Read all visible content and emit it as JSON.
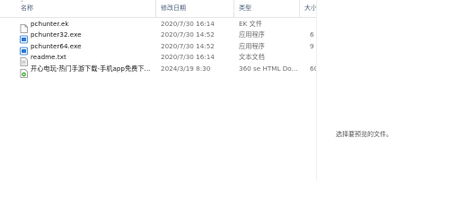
{
  "columns": {
    "name": "名称",
    "date": "修改日期",
    "type": "类型",
    "size": "大小"
  },
  "files": [
    {
      "name": "pchunter.ek",
      "date": "2020/7/30 16:14",
      "type": "EK 文件",
      "size": "",
      "icon": "blank-file-icon"
    },
    {
      "name": "pchunter32.exe",
      "date": "2020/7/30 14:52",
      "type": "应用程序",
      "size": "6",
      "icon": "exe-file-icon"
    },
    {
      "name": "pchunter64.exe",
      "date": "2020/7/30 14:52",
      "type": "应用程序",
      "size": "9",
      "icon": "exe-file-icon"
    },
    {
      "name": "readme.txt",
      "date": "2020/7/30 16:14",
      "type": "文本文档",
      "size": "",
      "icon": "text-file-icon"
    },
    {
      "name": "开心电玩-热门手游下载-手机app免费下...",
      "date": "2024/3/19 8:30",
      "type": "360 se HTML Do...",
      "size": "60",
      "icon": "html-file-icon"
    }
  ],
  "preview": {
    "message": "选择要预览的文件。"
  },
  "colors": {
    "header_text": "#4c607a",
    "exe_icon": "#2b78d0",
    "html_icon": "#3aa832"
  }
}
